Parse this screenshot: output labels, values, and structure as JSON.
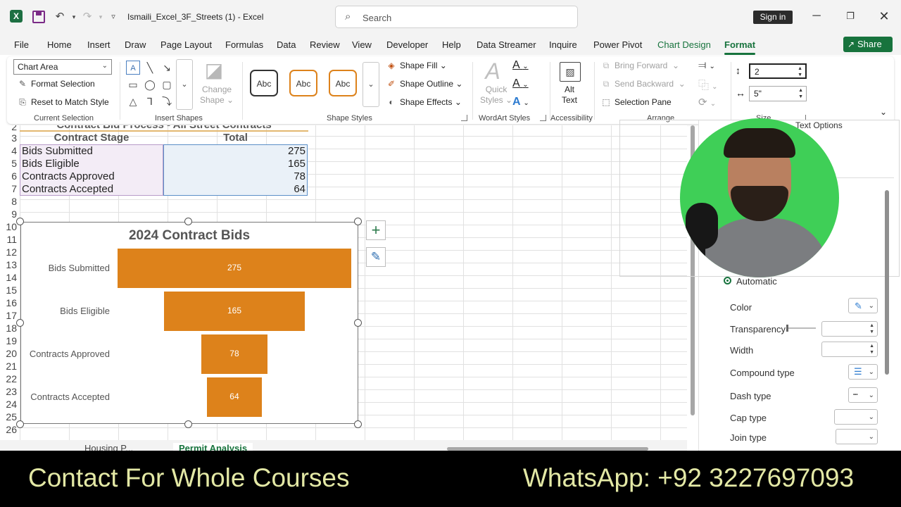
{
  "app": {
    "logo_letter": "X",
    "doc_title": "Ismaili_Excel_3F_Streets (1)  -  Excel",
    "search_placeholder": "Search",
    "sign_in": "Sign in"
  },
  "tabs": [
    "File",
    "Home",
    "Insert",
    "Draw",
    "Page Layout",
    "Formulas",
    "Data",
    "Review",
    "View",
    "Developer",
    "Help",
    "Data Streamer",
    "Inquire",
    "Power Pivot",
    "Chart Design",
    "Format"
  ],
  "active_tab": "Format",
  "share_label": "Share",
  "ribbon": {
    "current_selection": {
      "dropdown_value": "Chart Area",
      "format_selection": "Format Selection",
      "reset_style": "Reset to Match Style",
      "label": "Current Selection"
    },
    "insert_shapes": {
      "change_shape_l1": "Change",
      "change_shape_l2": "Shape",
      "label": "Insert Shapes"
    },
    "shape_styles": {
      "gallery": [
        "Abc",
        "Abc",
        "Abc"
      ],
      "fill": "Shape Fill",
      "outline": "Shape Outline",
      "effects": "Shape Effects",
      "label": "Shape Styles"
    },
    "wordart": {
      "quick_l1": "Quick",
      "quick_l2": "Styles",
      "label": "WordArt Styles"
    },
    "accessibility": {
      "alt_l1": "Alt",
      "alt_l2": "Text",
      "label": "Accessibility"
    },
    "arrange": {
      "bring_forward": "Bring Forward",
      "send_backward": "Send Backward",
      "selection_pane": "Selection Pane",
      "label": "Arrange"
    },
    "size": {
      "height_value": "2",
      "width_value": "5\"",
      "label": "Size"
    }
  },
  "sheet": {
    "row_numbers": [
      "2",
      "3",
      "4",
      "5",
      "6",
      "7",
      "8",
      "9",
      "10",
      "11",
      "12",
      "13",
      "14",
      "15",
      "16",
      "17",
      "18",
      "19",
      "20",
      "21",
      "22",
      "23",
      "24",
      "25",
      "26"
    ],
    "cut_title": "Contract Bid Process - All Street Contracts",
    "headers": [
      "Contract Stage",
      "Total"
    ],
    "rows": [
      {
        "stage": "Bids Submitted",
        "total": "275"
      },
      {
        "stage": "Bids Eligible",
        "total": "165"
      },
      {
        "stage": "Contracts Approved",
        "total": "78"
      },
      {
        "stage": "Contracts Accepted",
        "total": "64"
      }
    ],
    "sheet_tabs": [
      "Housing P...",
      "Permit Analysis"
    ],
    "active_sheet": "Permit Analysis"
  },
  "chart_data": {
    "type": "bar",
    "subtype": "funnel",
    "title": "2024 Contract Bids",
    "categories": [
      "Bids Submitted",
      "Bids Eligible",
      "Contracts Approved",
      "Contracts Accepted"
    ],
    "values": [
      275,
      165,
      78,
      64
    ],
    "xlim": [
      0,
      275
    ],
    "color": "#dd821b",
    "data_labels": true,
    "legend": "none",
    "grid": false
  },
  "pane": {
    "tab_label": "Text Options",
    "automatic": "Automatic",
    "color": "Color",
    "transparency": "Transparency",
    "width": "Width",
    "compound_type": "Compound type",
    "dash_type": "Dash type",
    "cap_type": "Cap type",
    "join_type": "Join type"
  },
  "banner": {
    "left": "Contact For Whole Courses",
    "right": "WhatsApp:  +92 3227697093"
  },
  "colors": {
    "excel_green": "#17733d",
    "bar_orange": "#dd821b",
    "banner_text": "#e3e8a5"
  }
}
